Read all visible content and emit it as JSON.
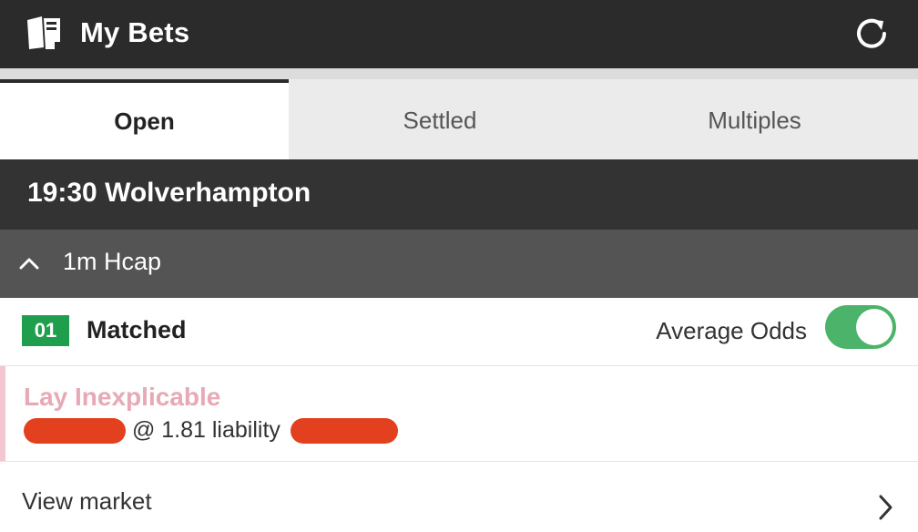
{
  "header": {
    "title": "My Bets",
    "logo_icon": "betslip-icon",
    "refresh_icon": "refresh-icon"
  },
  "tabs": [
    {
      "label": "Open",
      "active": true
    },
    {
      "label": "Settled",
      "active": false
    },
    {
      "label": "Multiples",
      "active": false
    }
  ],
  "event": {
    "name": "19:30 Wolverhampton"
  },
  "market": {
    "name": "1m Hcap",
    "expand_icon": "chevron-up-icon"
  },
  "matched": {
    "count": "01",
    "label": "Matched",
    "average_odds_label": "Average Odds",
    "average_odds_on": true
  },
  "bet": {
    "selection": "Lay Inexplicable",
    "odds_text": "@ 1.81 liability",
    "stripe_color": "#f2c7d1",
    "redaction_color": "#e2401f"
  },
  "footer": {
    "view_market_label": "View market",
    "arrow_icon": "chevron-right-icon"
  },
  "colors": {
    "header_bg": "#2b2b2b",
    "event_bg": "#333333",
    "market_bg": "#545454",
    "badge_green": "#1f9f4d",
    "toggle_green": "#4cb46a",
    "lay_pink": "#e7a9b6"
  }
}
